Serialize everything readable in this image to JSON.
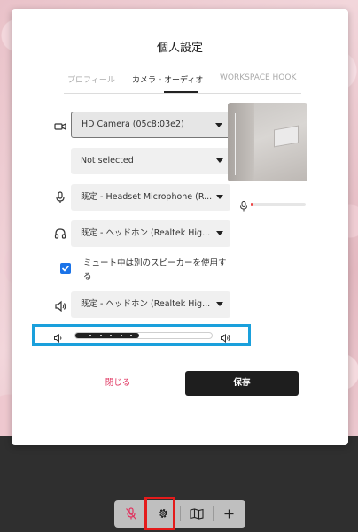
{
  "modal": {
    "title": "個人設定",
    "tabs": [
      {
        "label": "プロフィール",
        "active": false
      },
      {
        "label": "カメラ・オーディオ",
        "active": true
      },
      {
        "label": "WORKSPACE HOOK",
        "active": false
      }
    ]
  },
  "devices": {
    "camera": {
      "value": "HD Camera (05c8:03e2)",
      "icon": "video-camera-icon"
    },
    "virtual_background": {
      "value": "Not selected"
    },
    "microphone": {
      "value": "既定 - Headset Microphone (R...",
      "icon": "microphone-icon"
    },
    "headphones": {
      "value": "既定 - ヘッドホン (Realtek Hig...",
      "icon": "headphones-icon"
    },
    "speaker": {
      "value": "既定 - ヘッドホン (Realtek Hig...",
      "icon": "speaker-icon"
    }
  },
  "mute_option": {
    "checked": true,
    "label": "ミュート中は別のスピーカーを使用する"
  },
  "volume": {
    "level": 0.47
  },
  "mic_level": {
    "level": 0.03
  },
  "buttons": {
    "close": "閉じる",
    "save": "保存"
  },
  "toolbar": {
    "items": [
      "microphone-muted-icon",
      "gear-icon",
      "map-icon",
      "plus-icon"
    ]
  },
  "colors": {
    "accent_pink": "#e0335f",
    "checkbox_blue": "#1a73e8",
    "annotation_blue": "#1aa0dc",
    "annotation_red": "#e41b1b"
  }
}
